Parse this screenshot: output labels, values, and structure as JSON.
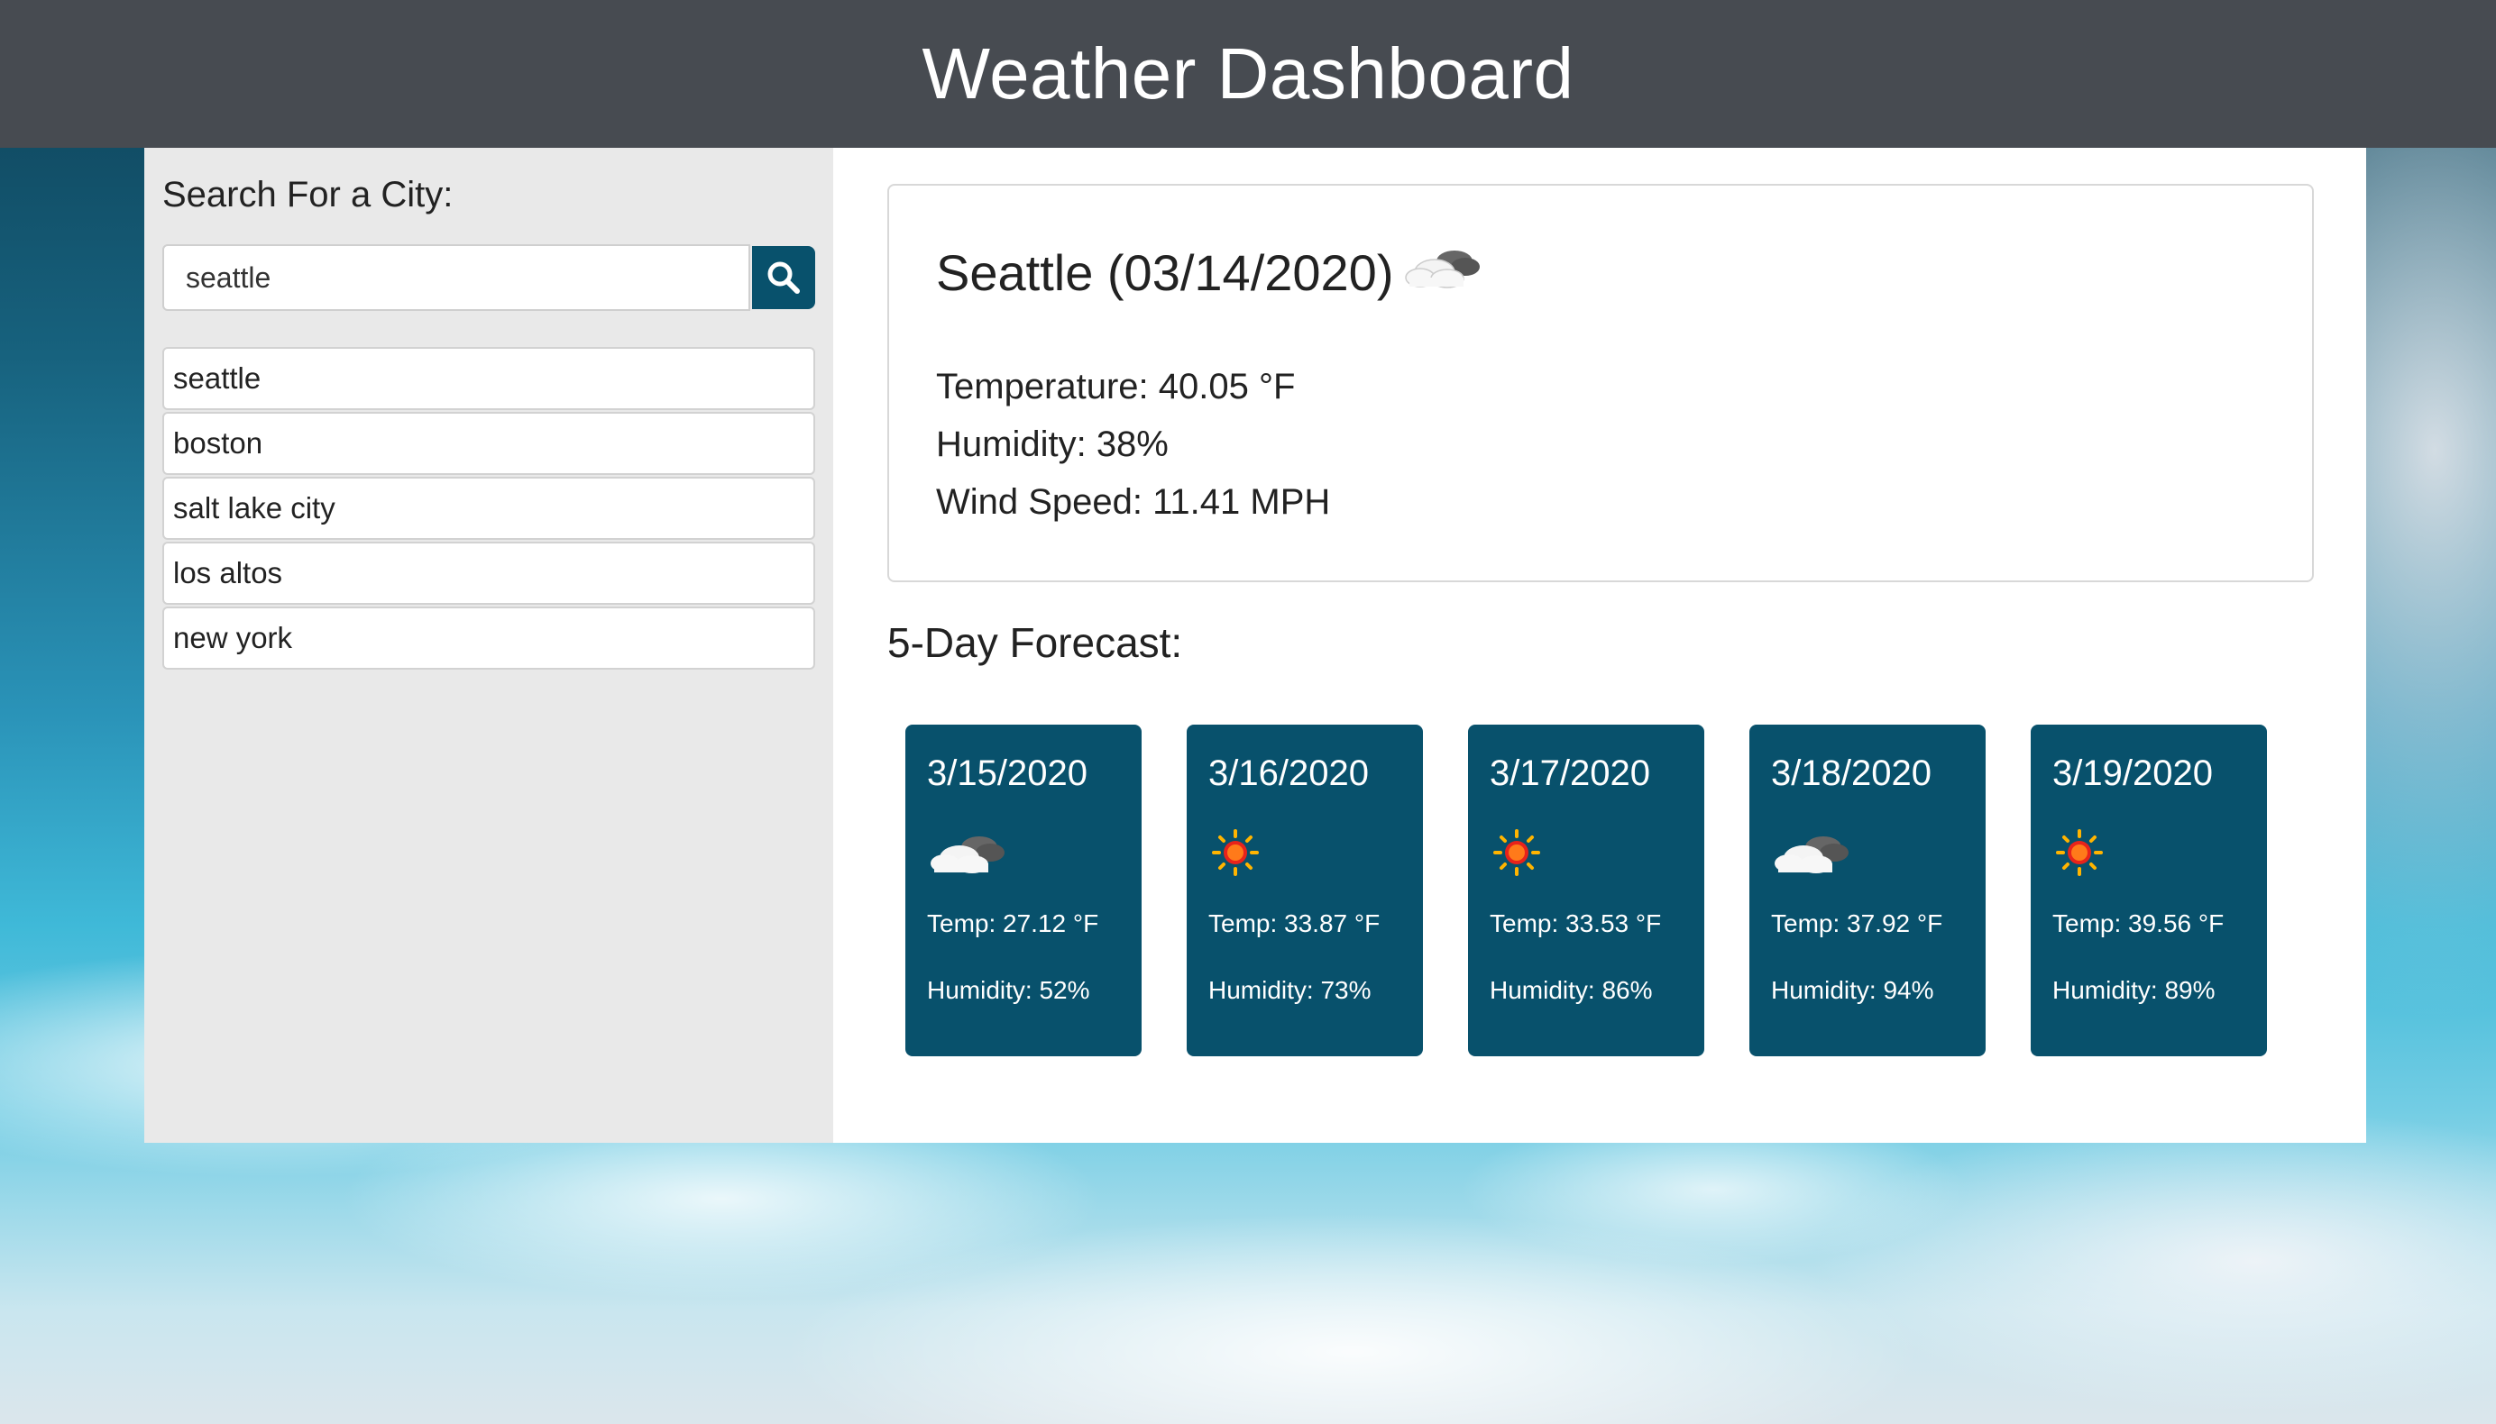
{
  "header": {
    "title": "Weather Dashboard"
  },
  "sidebar": {
    "title": "Search For a City:",
    "search": {
      "value": "seattle",
      "placeholder": ""
    },
    "history": [
      {
        "label": "seattle"
      },
      {
        "label": "boston"
      },
      {
        "label": "salt lake city"
      },
      {
        "label": "los altos"
      },
      {
        "label": "new york"
      }
    ]
  },
  "current": {
    "title": "Seattle (03/14/2020)",
    "icon": "partly-cloudy-icon",
    "temperature": "Temperature: 40.05 °F",
    "humidity": "Humidity: 38%",
    "wind": "Wind Speed: 11.41 MPH"
  },
  "forecast": {
    "heading": "5-Day Forecast:",
    "days": [
      {
        "date": "3/15/2020",
        "icon": "partly-cloudy-icon",
        "temp": "Temp: 27.12 °F",
        "humidity": "Humidity: 52%"
      },
      {
        "date": "3/16/2020",
        "icon": "sun-icon",
        "temp": "Temp: 33.87 °F",
        "humidity": "Humidity: 73%"
      },
      {
        "date": "3/17/2020",
        "icon": "sun-icon",
        "temp": "Temp: 33.53 °F",
        "humidity": "Humidity: 86%"
      },
      {
        "date": "3/18/2020",
        "icon": "partly-cloudy-icon",
        "temp": "Temp: 37.92 °F",
        "humidity": "Humidity: 94%"
      },
      {
        "date": "3/19/2020",
        "icon": "sun-icon",
        "temp": "Temp: 39.56 °F",
        "humidity": "Humidity: 89%"
      }
    ]
  },
  "colors": {
    "header_bg": "#474b51",
    "accent": "#08516c",
    "sidebar_bg": "#e9e9e9"
  }
}
